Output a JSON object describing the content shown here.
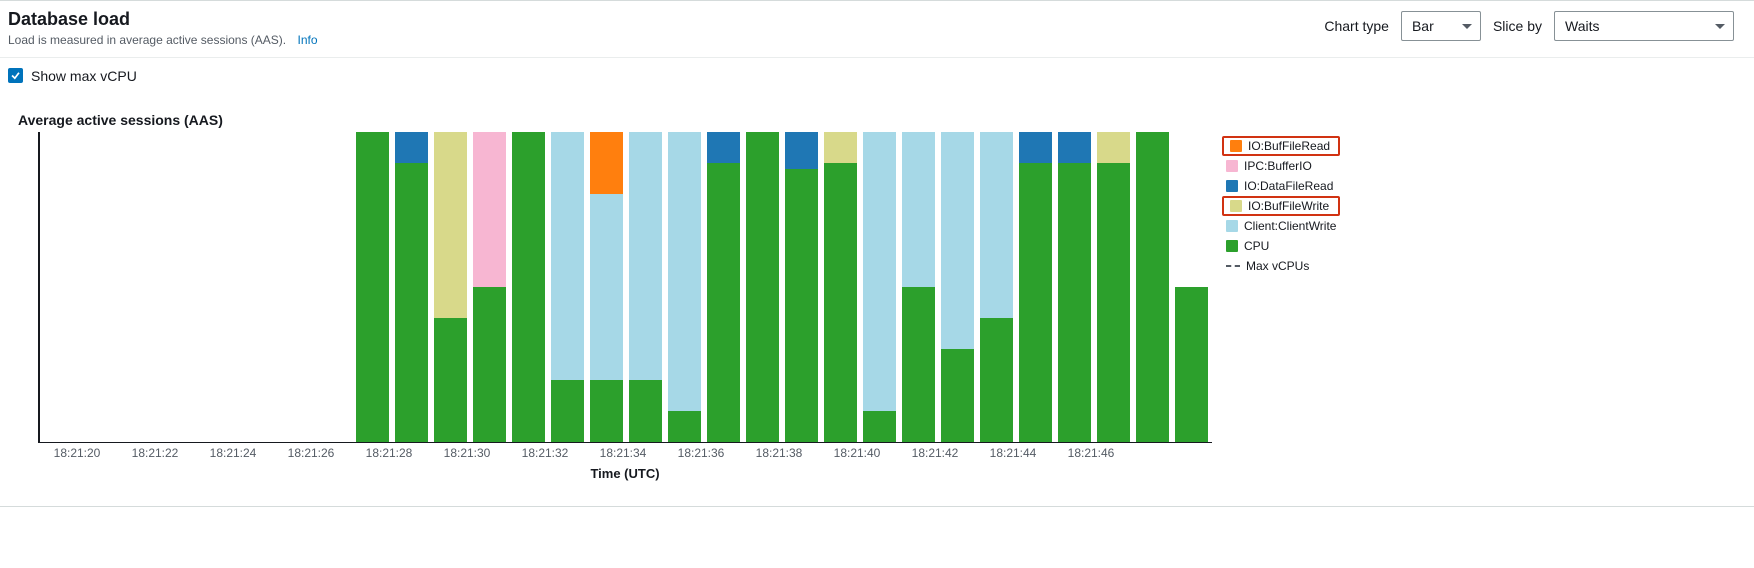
{
  "header": {
    "title": "Database load",
    "subtitle": "Load is measured in average active sessions (AAS).",
    "info_link": "Info",
    "chart_type_label": "Chart type",
    "chart_type_value": "Bar",
    "slice_by_label": "Slice by",
    "slice_by_value": "Waits"
  },
  "controls": {
    "show_max_vcpu_label": "Show max vCPU",
    "show_max_vcpu_checked": true
  },
  "chart": {
    "title": "Average active sessions (AAS)",
    "xlabel": "Time (UTC)"
  },
  "legend": {
    "items": [
      {
        "name": "IO:BufFileRead",
        "color": "c-bufread",
        "highlight": true
      },
      {
        "name": "IPC:BufferIO",
        "color": "c-ipcbuf",
        "highlight": false
      },
      {
        "name": "IO:DataFileRead",
        "color": "c-datafile",
        "highlight": false
      },
      {
        "name": "IO:BufFileWrite",
        "color": "c-bufwrite",
        "highlight": true
      },
      {
        "name": "Client:ClientWrite",
        "color": "c-client",
        "highlight": false
      },
      {
        "name": "CPU",
        "color": "c-cpu",
        "highlight": false
      }
    ],
    "max_vcpu_label": "Max vCPUs"
  },
  "chart_data": {
    "type": "bar",
    "title": "Average active sessions (AAS)",
    "xlabel": "Time (UTC)",
    "ylabel": "",
    "ylim": [
      0,
      1
    ],
    "x_tick_labels": [
      "18:21:20",
      "18:21:22",
      "18:21:24",
      "18:21:26",
      "18:21:28",
      "18:21:30",
      "18:21:32",
      "18:21:34",
      "18:21:36",
      "18:21:38",
      "18:21:40",
      "18:21:42",
      "18:21:44",
      "18:21:46"
    ],
    "tick_positions": [
      0.5,
      2.5,
      4.5,
      6.5,
      8.5,
      10.5,
      12.5,
      14.5,
      16.5,
      18.5,
      20.5,
      22.5,
      24.5,
      26.5
    ],
    "series_order_bottom_to_top": [
      "CPU",
      "Client:ClientWrite",
      "IO:BufFileWrite",
      "IO:DataFileRead",
      "IPC:BufferIO",
      "IO:BufFileRead"
    ],
    "series_colors": {
      "CPU": "#2ca02c",
      "Client:ClientWrite": "#a6d8e7",
      "IO:BufFileWrite": "#d8d98a",
      "IO:DataFileRead": "#1f77b4",
      "IPC:BufferIO": "#f7b6d2",
      "IO:BufFileRead": "#ff7f0e"
    },
    "bars": [
      {
        "CPU": 0,
        "Client:ClientWrite": 0,
        "IO:BufFileWrite": 0,
        "IO:DataFileRead": 0,
        "IPC:BufferIO": 0,
        "IO:BufFileRead": 0
      },
      {
        "CPU": 0,
        "Client:ClientWrite": 0,
        "IO:BufFileWrite": 0,
        "IO:DataFileRead": 0,
        "IPC:BufferIO": 0,
        "IO:BufFileRead": 0
      },
      {
        "CPU": 0,
        "Client:ClientWrite": 0,
        "IO:BufFileWrite": 0,
        "IO:DataFileRead": 0,
        "IPC:BufferIO": 0,
        "IO:BufFileRead": 0
      },
      {
        "CPU": 0,
        "Client:ClientWrite": 0,
        "IO:BufFileWrite": 0,
        "IO:DataFileRead": 0,
        "IPC:BufferIO": 0,
        "IO:BufFileRead": 0
      },
      {
        "CPU": 0,
        "Client:ClientWrite": 0,
        "IO:BufFileWrite": 0,
        "IO:DataFileRead": 0,
        "IPC:BufferIO": 0,
        "IO:BufFileRead": 0
      },
      {
        "CPU": 0,
        "Client:ClientWrite": 0,
        "IO:BufFileWrite": 0,
        "IO:DataFileRead": 0,
        "IPC:BufferIO": 0,
        "IO:BufFileRead": 0
      },
      {
        "CPU": 0,
        "Client:ClientWrite": 0,
        "IO:BufFileWrite": 0,
        "IO:DataFileRead": 0,
        "IPC:BufferIO": 0,
        "IO:BufFileRead": 0
      },
      {
        "CPU": 0,
        "Client:ClientWrite": 0,
        "IO:BufFileWrite": 0,
        "IO:DataFileRead": 0,
        "IPC:BufferIO": 0,
        "IO:BufFileRead": 0
      },
      {
        "CPU": 1.0,
        "Client:ClientWrite": 0,
        "IO:BufFileWrite": 0,
        "IO:DataFileRead": 0,
        "IPC:BufferIO": 0,
        "IO:BufFileRead": 0
      },
      {
        "CPU": 0.9,
        "Client:ClientWrite": 0,
        "IO:BufFileWrite": 0,
        "IO:DataFileRead": 0.1,
        "IPC:BufferIO": 0,
        "IO:BufFileRead": 0
      },
      {
        "CPU": 0.4,
        "Client:ClientWrite": 0,
        "IO:BufFileWrite": 0.6,
        "IO:DataFileRead": 0,
        "IPC:BufferIO": 0,
        "IO:BufFileRead": 0
      },
      {
        "CPU": 0.5,
        "Client:ClientWrite": 0,
        "IO:BufFileWrite": 0,
        "IO:DataFileRead": 0,
        "IPC:BufferIO": 0.5,
        "IO:BufFileRead": 0
      },
      {
        "CPU": 1.0,
        "Client:ClientWrite": 0,
        "IO:BufFileWrite": 0,
        "IO:DataFileRead": 0,
        "IPC:BufferIO": 0,
        "IO:BufFileRead": 0
      },
      {
        "CPU": 0.2,
        "Client:ClientWrite": 0.8,
        "IO:BufFileWrite": 0,
        "IO:DataFileRead": 0,
        "IPC:BufferIO": 0,
        "IO:BufFileRead": 0
      },
      {
        "CPU": 0.2,
        "Client:ClientWrite": 0.6,
        "IO:BufFileWrite": 0,
        "IO:DataFileRead": 0,
        "IPC:BufferIO": 0,
        "IO:BufFileRead": 0.2
      },
      {
        "CPU": 0.2,
        "Client:ClientWrite": 0.8,
        "IO:BufFileWrite": 0,
        "IO:DataFileRead": 0,
        "IPC:BufferIO": 0,
        "IO:BufFileRead": 0
      },
      {
        "CPU": 0.1,
        "Client:ClientWrite": 0.9,
        "IO:BufFileWrite": 0,
        "IO:DataFileRead": 0,
        "IPC:BufferIO": 0,
        "IO:BufFileRead": 0
      },
      {
        "CPU": 0.9,
        "Client:ClientWrite": 0,
        "IO:BufFileWrite": 0,
        "IO:DataFileRead": 0.1,
        "IPC:BufferIO": 0,
        "IO:BufFileRead": 0
      },
      {
        "CPU": 1.0,
        "Client:ClientWrite": 0,
        "IO:BufFileWrite": 0,
        "IO:DataFileRead": 0,
        "IPC:BufferIO": 0,
        "IO:BufFileRead": 0
      },
      {
        "CPU": 0.88,
        "Client:ClientWrite": 0,
        "IO:BufFileWrite": 0,
        "IO:DataFileRead": 0.12,
        "IPC:BufferIO": 0,
        "IO:BufFileRead": 0
      },
      {
        "CPU": 0.9,
        "Client:ClientWrite": 0,
        "IO:BufFileWrite": 0.1,
        "IO:DataFileRead": 0,
        "IPC:BufferIO": 0,
        "IO:BufFileRead": 0
      },
      {
        "CPU": 0.1,
        "Client:ClientWrite": 0.9,
        "IO:BufFileWrite": 0,
        "IO:DataFileRead": 0,
        "IPC:BufferIO": 0,
        "IO:BufFileRead": 0
      },
      {
        "CPU": 0.5,
        "Client:ClientWrite": 0.5,
        "IO:BufFileWrite": 0,
        "IO:DataFileRead": 0,
        "IPC:BufferIO": 0,
        "IO:BufFileRead": 0
      },
      {
        "CPU": 0.3,
        "Client:ClientWrite": 0.7,
        "IO:BufFileWrite": 0,
        "IO:DataFileRead": 0,
        "IPC:BufferIO": 0,
        "IO:BufFileRead": 0
      },
      {
        "CPU": 0.4,
        "Client:ClientWrite": 0.6,
        "IO:BufFileWrite": 0,
        "IO:DataFileRead": 0,
        "IPC:BufferIO": 0,
        "IO:BufFileRead": 0
      },
      {
        "CPU": 0.9,
        "Client:ClientWrite": 0,
        "IO:BufFileWrite": 0,
        "IO:DataFileRead": 0.1,
        "IPC:BufferIO": 0,
        "IO:BufFileRead": 0
      },
      {
        "CPU": 0.9,
        "Client:ClientWrite": 0,
        "IO:BufFileWrite": 0,
        "IO:DataFileRead": 0.1,
        "IPC:BufferIO": 0,
        "IO:BufFileRead": 0
      },
      {
        "CPU": 0.9,
        "Client:ClientWrite": 0,
        "IO:BufFileWrite": 0.1,
        "IO:DataFileRead": 0,
        "IPC:BufferIO": 0,
        "IO:BufFileRead": 0
      },
      {
        "CPU": 1.0,
        "Client:ClientWrite": 0,
        "IO:BufFileWrite": 0,
        "IO:DataFileRead": 0,
        "IPC:BufferIO": 0,
        "IO:BufFileRead": 0
      },
      {
        "CPU": 0.5,
        "Client:ClientWrite": 0,
        "IO:BufFileWrite": 0,
        "IO:DataFileRead": 0,
        "IPC:BufferIO": 0,
        "IO:BufFileRead": 0
      }
    ]
  }
}
